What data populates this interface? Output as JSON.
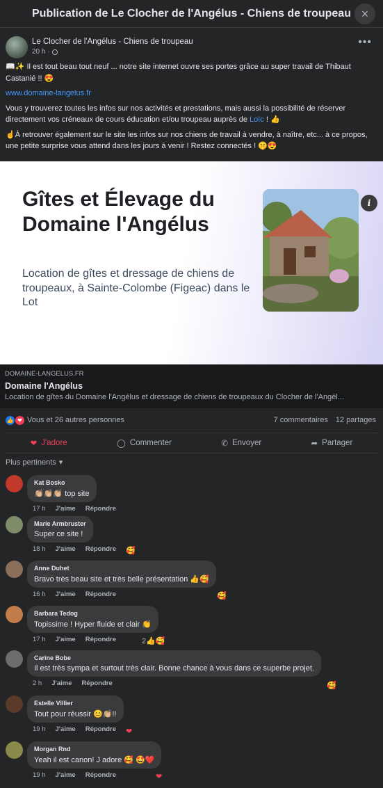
{
  "header": {
    "title": "Publication de Le Clocher de l'Angélus - Chiens de troupeau",
    "close_icon": "×"
  },
  "post": {
    "author": "Le Clocher de l'Angélus - Chiens de troupeau",
    "time": "20 h ·",
    "more": "•••",
    "paragraph1": "📖✨ Il est tout beau tout neuf ... notre site internet ouvre ses portes grâce au super travail de Thibaut Castanié !! 😍",
    "url": "www.domaine-langelus.fr",
    "paragraph3a": "Vous y trouverez toutes les infos sur nos activités et prestations, mais aussi la possibilité de réserver directement vos créneaux de cours éducation et/ou troupeau auprès de ",
    "mention": "Loïc",
    "paragraph3b": " ! 👍",
    "paragraph4": "☝À retrouver également sur le site les infos sur nos chiens de travail à vendre, à naître, etc... à ce propos, une petite surprise vous attend dans les jours à venir ! Restez connectés ! 🤫😍"
  },
  "preview": {
    "title": "Gîtes et Élevage du Domaine l'Angélus",
    "description": "Location de gîtes et dressage de chiens de troupeaux, à Sainte-Colombe (Figeac) dans le Lot",
    "info": "i"
  },
  "link_card": {
    "domain": "DOMAINE-LANGELUS.FR",
    "title": "Domaine l'Angélus",
    "description": "Location de gîtes du Domaine l'Angélus et dressage de chiens de troupeaux du Clocher de l'Angél..."
  },
  "stats": {
    "reactions": "Vous et 26 autres personnes",
    "comments": "7 commentaires",
    "shares": "12 partages"
  },
  "actions": {
    "love": "J'adore",
    "comment": "Commenter",
    "send": "Envoyer",
    "share": "Partager"
  },
  "filter": "Plus pertinents",
  "comments": [
    {
      "name": "Kat Bosko",
      "text": "👏🏼👏🏼👏🏼 top site",
      "time": "17 h",
      "like": "J'aime",
      "reply": "Répondre",
      "reaction": ""
    },
    {
      "name": "Marie Armbruster",
      "text": "Super ce site !",
      "time": "18 h",
      "like": "J'aime",
      "reply": "Répondre",
      "reaction": "🥰"
    },
    {
      "name": "Anne Duhet",
      "text": "Bravo très beau site et très belle présentation 👍🥰",
      "time": "16 h",
      "like": "J'aime",
      "reply": "Répondre",
      "reaction": "🥰"
    },
    {
      "name": "Barbara Tedog",
      "text": "Topissime ! Hyper fluide et clair 👏",
      "time": "17 h",
      "like": "J'aime",
      "reply": "Répondre",
      "reaction": "2👍🥰"
    },
    {
      "name": "Carine Bobe",
      "text": "Il est très sympa et surtout très clair. Bonne chance à vous dans ce superbe projet.",
      "time": "2 h",
      "like": "J'aime",
      "reply": "Répondre",
      "reaction": "🥰"
    },
    {
      "name": "Estelle Villier",
      "text": "Tout pour réussir 😊👏🏼!!",
      "time": "19 h",
      "like": "J'aime",
      "reply": "Répondre",
      "reaction": "❤"
    },
    {
      "name": "Morgan Rnd",
      "text": "Yeah il est canon! J adore 🥰 🤩❤️",
      "time": "19 h",
      "like": "J'aime",
      "reply": "Répondre",
      "reaction": "❤"
    }
  ]
}
